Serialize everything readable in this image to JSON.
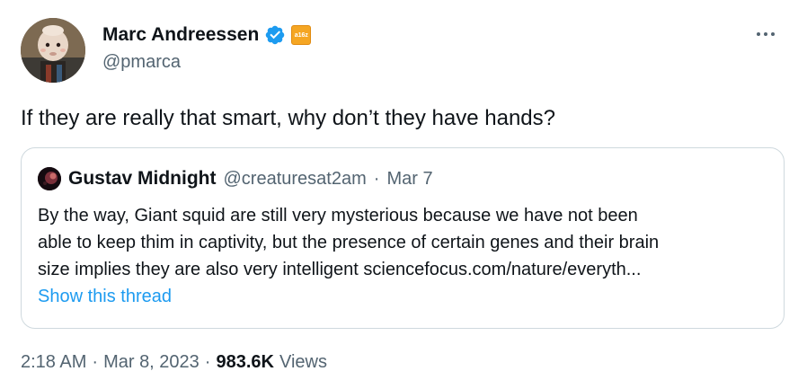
{
  "author": {
    "display_name": "Marc Andreessen",
    "handle": "@pmarca",
    "affiliation_badge": "a16z",
    "verified_icon": "verified-badge-icon",
    "more_icon": "more-options-icon"
  },
  "tweet": {
    "text": "If they are really that smart, why don’t they have hands?"
  },
  "quote": {
    "display_name": "Gustav Midnight",
    "handle": "@creaturesat2am",
    "separator": "·",
    "date": "Mar 7",
    "lines": [
      "By the way, Giant squid are still very mysterious because we have not been",
      "able to keep thim in captivity, but the presence of certain genes and their brain",
      "size implies they are also very intelligent sciencefocus.com/nature/everyth..."
    ],
    "show_thread": "Show this thread"
  },
  "meta": {
    "time": "2:18 AM",
    "sep1": "·",
    "date": "Mar 8, 2023",
    "sep2": "·",
    "views_count": "983.6K",
    "views_label": "Views"
  },
  "colors": {
    "accent": "#1d9bf0",
    "secondary_text": "#536471",
    "border": "#cfd9de",
    "badge": "#f5a623"
  }
}
